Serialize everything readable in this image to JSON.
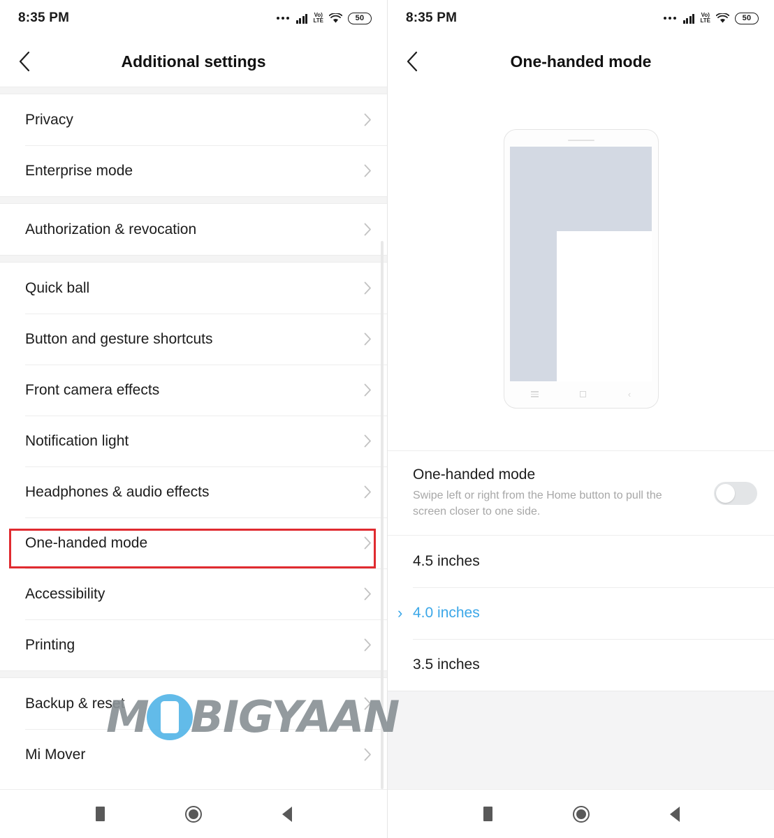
{
  "status_bar": {
    "time": "8:35 PM",
    "battery_level": "50",
    "network_label_top": "Vo)",
    "network_label_bottom": "LTE",
    "icons": [
      "more-dots-icon",
      "signal-icon",
      "volte-icon",
      "wifi-icon",
      "battery-icon"
    ]
  },
  "left_panel": {
    "title": "Additional settings",
    "back_icon": "chevron-left-icon",
    "groups": [
      {
        "items": [
          {
            "label": "Privacy"
          },
          {
            "label": "Enterprise mode"
          }
        ]
      },
      {
        "items": [
          {
            "label": "Authorization & revocation"
          }
        ]
      },
      {
        "items": [
          {
            "label": "Quick ball"
          },
          {
            "label": "Button and gesture shortcuts"
          },
          {
            "label": "Front camera effects"
          },
          {
            "label": "Notification light"
          },
          {
            "label": "Headphones & audio effects"
          },
          {
            "label": "One-handed mode",
            "highlighted": true
          },
          {
            "label": "Accessibility"
          },
          {
            "label": "Printing"
          }
        ]
      },
      {
        "items": [
          {
            "label": "Backup & reset"
          },
          {
            "label": "Mi Mover"
          }
        ]
      }
    ],
    "highlight_color": "#e02b30",
    "chevron_icon": "chevron-right-icon"
  },
  "right_panel": {
    "title": "One-handed mode",
    "back_icon": "chevron-left-icon",
    "illustration": {
      "name": "phone-one-handed-preview",
      "screen_color": "#d3d9e3",
      "shrunk_area_color": "#ffffff"
    },
    "toggle": {
      "title": "One-handed mode",
      "description": "Swipe left or right from the Home button to pull the screen closer to one side.",
      "state": "off"
    },
    "size_options": [
      {
        "label": "4.5 inches",
        "selected": false
      },
      {
        "label": "4.0 inches",
        "selected": true
      },
      {
        "label": "3.5 inches",
        "selected": false
      }
    ],
    "selected_color": "#3ba7e8"
  },
  "nav_bar": {
    "buttons": [
      "recents-button",
      "home-button",
      "back-button"
    ]
  },
  "watermark": {
    "text_before": "M",
    "text_after": "BIGYAAN",
    "accent_color": "#55b6e8",
    "text_color": "#8a9296"
  }
}
